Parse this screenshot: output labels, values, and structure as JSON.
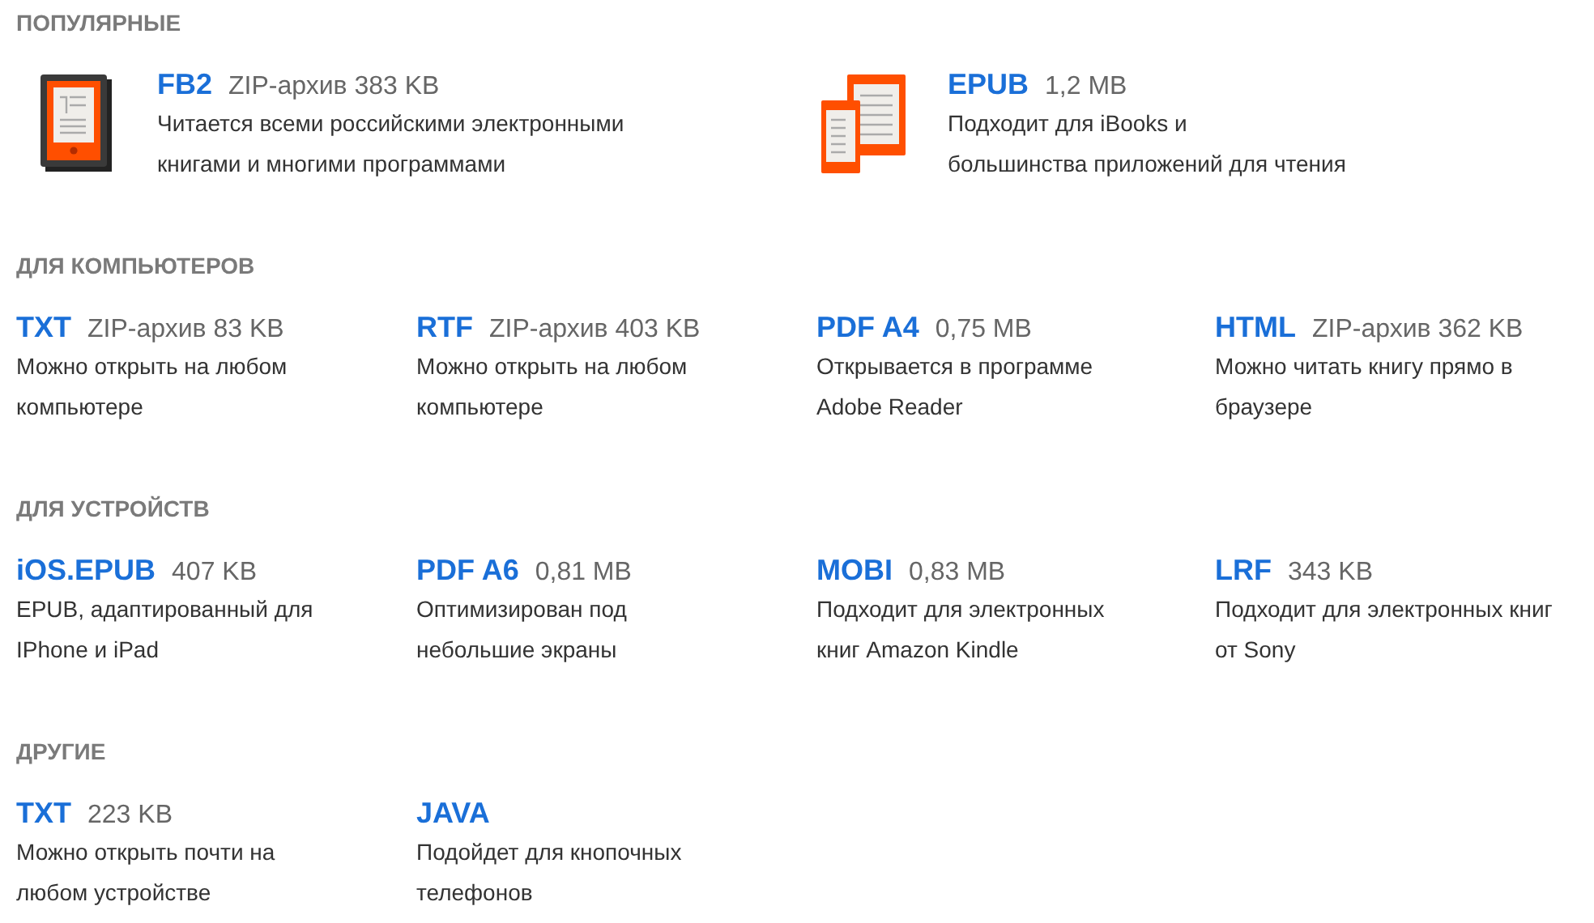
{
  "sections": [
    {
      "title": "ПОПУЛЯРНЫЕ",
      "kind": "popular",
      "items": [
        {
          "format": "FB2",
          "size": "ZIP-архив 383 KB",
          "kind": "reader",
          "description": [
            "Читается всеми российскими электронными",
            "книгами и многими программами"
          ]
        },
        {
          "format": "EPUB",
          "size": "1,2 MB",
          "kind": "tablets",
          "description": [
            "Подходит для iBooks и",
            "большинства приложений для чтения"
          ]
        }
      ]
    },
    {
      "title": "ДЛЯ КОМПЬЮТЕРОВ",
      "kind": "grid",
      "items": [
        {
          "format": "TXT",
          "size": "ZIP-архив 83 KB",
          "description": [
            "Можно открыть на любом",
            "компьютере"
          ]
        },
        {
          "format": "RTF",
          "size": "ZIP-архив 403 KB",
          "description": [
            "Можно открыть на любом",
            "компьютере"
          ]
        },
        {
          "format": "PDF A4",
          "size": "0,75 MB",
          "description": [
            "Открывается в программе",
            "Adobe Reader"
          ]
        },
        {
          "format": "HTML",
          "size": "ZIP-архив 362 KB",
          "description": [
            "Можно читать книгу прямо в",
            "браузере"
          ]
        }
      ]
    },
    {
      "title": "ДЛЯ УСТРОЙСТВ",
      "kind": "grid",
      "items": [
        {
          "format": "iOS.EPUB",
          "size": "407 KB",
          "description": [
            "EPUB, адаптированный для",
            "IPhone и iPad"
          ]
        },
        {
          "format": "PDF A6",
          "size": "0,81 MB",
          "description": [
            "Оптимизирован под",
            "небольшие экраны"
          ]
        },
        {
          "format": "MOBI",
          "size": "0,83 MB",
          "description": [
            "Подходит для электронных",
            "книг Amazon Kindle"
          ]
        },
        {
          "format": "LRF",
          "size": "343 KB",
          "description": [
            "Подходит для электронных книг",
            "от Sony"
          ]
        }
      ]
    },
    {
      "title": "ДРУГИЕ",
      "kind": "grid",
      "items": [
        {
          "format": "TXT",
          "size": "223 KB",
          "description": [
            "Можно открыть почти на",
            "любом устройстве"
          ]
        },
        {
          "format": "JAVA",
          "description": [
            "Подойдет для кнопочных",
            "телефонов"
          ]
        }
      ]
    }
  ]
}
